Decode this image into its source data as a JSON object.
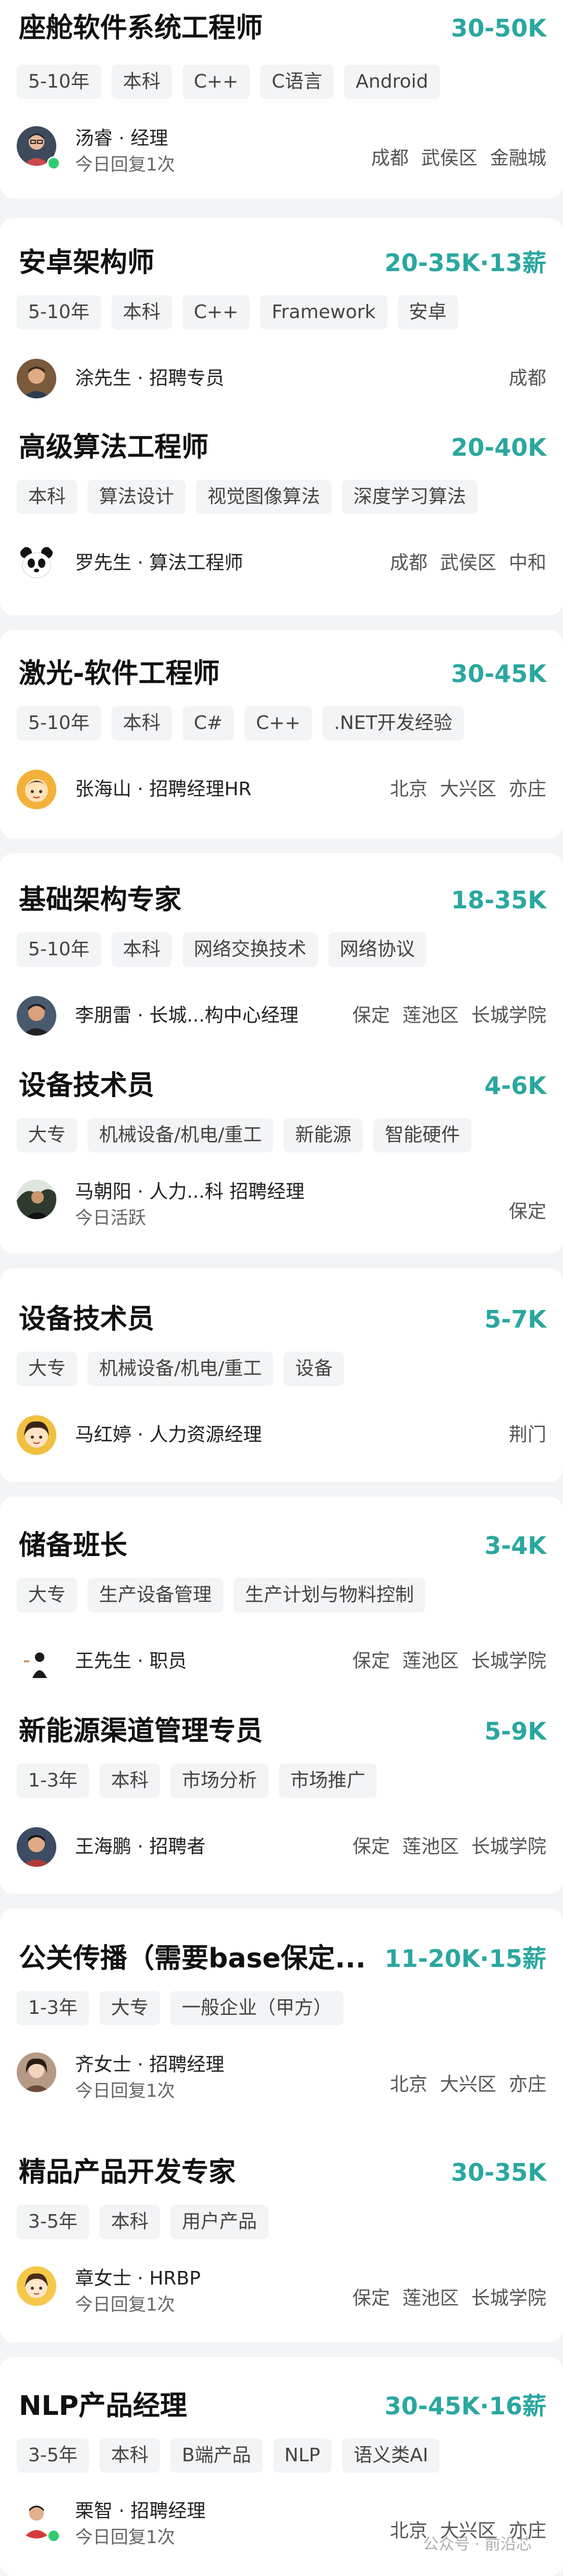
{
  "jobs": [
    {
      "title": "座舱软件系统工程师",
      "salary": "30-50K",
      "tags": [
        "5-10年",
        "本科",
        "C++",
        "C语言",
        "Android"
      ],
      "recruiter": "汤睿 · 经理",
      "status": "今日回复1次",
      "online": true,
      "location": [
        "成都",
        "武侯区",
        "金融城"
      ],
      "avatar": "avatar-man-glasses"
    },
    {
      "title": "安卓架构师",
      "salary": "20-35K·13薪",
      "tags": [
        "5-10年",
        "本科",
        "C++",
        "Framework",
        "安卓"
      ],
      "recruiter": "涂先生 · 招聘专员",
      "status": "",
      "online": false,
      "location": [
        "成都"
      ],
      "avatar": "avatar-man"
    },
    {
      "title": "高级算法工程师",
      "salary": "20-40K",
      "tags": [
        "本科",
        "算法设计",
        "视觉图像算法",
        "深度学习算法"
      ],
      "recruiter": "罗先生 · 算法工程师",
      "status": "",
      "online": false,
      "location": [
        "成都",
        "武侯区",
        "中和"
      ],
      "avatar": "avatar-panda"
    },
    {
      "title": "激光-软件工程师",
      "salary": "30-45K",
      "tags": [
        "5-10年",
        "本科",
        "C#",
        "C++",
        ".NET开发经验"
      ],
      "recruiter": "张海山 · 招聘经理HR",
      "status": "",
      "online": false,
      "location": [
        "北京",
        "大兴区",
        "亦庄"
      ],
      "avatar": "avatar-cartoon"
    },
    {
      "title": "基础架构专家",
      "salary": "18-35K",
      "tags": [
        "5-10年",
        "本科",
        "网络交换技术",
        "网络协议"
      ],
      "recruiter": "李朋雷 · 长城...构中心经理",
      "status": "",
      "online": false,
      "location": [
        "保定",
        "莲池区",
        "长城学院"
      ],
      "avatar": "avatar-man"
    },
    {
      "title": "设备技术员",
      "salary": "4-6K",
      "tags": [
        "大专",
        "机械设备/机电/重工",
        "新能源",
        "智能硬件"
      ],
      "recruiter": "马朝阳 · 人力...科 招聘经理",
      "status": "今日活跃",
      "online": false,
      "location": [
        "保定"
      ],
      "avatar": "avatar-photo"
    },
    {
      "title": "设备技术员",
      "salary": "5-7K",
      "tags": [
        "大专",
        "机械设备/机电/重工",
        "设备"
      ],
      "recruiter": "马红婷 · 人力资源经理",
      "status": "",
      "online": false,
      "location": [
        "荆门"
      ],
      "avatar": "avatar-cartoon"
    },
    {
      "title": "储备班长",
      "salary": "3-4K",
      "tags": [
        "大专",
        "生产设备管理",
        "生产计划与物料控制"
      ],
      "recruiter": "王先生 · 职员",
      "status": "",
      "online": false,
      "location": [
        "保定",
        "莲池区",
        "长城学院"
      ],
      "avatar": "avatar-small"
    },
    {
      "title": "新能源渠道管理专员",
      "salary": "5-9K",
      "tags": [
        "1-3年",
        "本科",
        "市场分析",
        "市场推广"
      ],
      "recruiter": "王海鹏 · 招聘者",
      "status": "",
      "online": false,
      "location": [
        "保定",
        "莲池区",
        "长城学院"
      ],
      "avatar": "avatar-man"
    },
    {
      "title": "公关传播（需要base保定...",
      "salary": "11-20K·15薪",
      "tags": [
        "1-3年",
        "大专",
        "一般企业（甲方）"
      ],
      "recruiter": "齐女士 · 招聘经理",
      "status": "今日回复1次",
      "online": false,
      "location": [
        "北京",
        "大兴区",
        "亦庄"
      ],
      "avatar": "avatar-woman"
    },
    {
      "title": "精品产品开发专家",
      "salary": "30-35K",
      "tags": [
        "3-5年",
        "本科",
        "用户产品"
      ],
      "recruiter": "章女士 · HRBP",
      "status": "今日回复1次",
      "online": false,
      "location": [
        "保定",
        "莲池区",
        "长城学院"
      ],
      "avatar": "avatar-cartoon"
    },
    {
      "title": "NLP产品经理",
      "salary": "30-45K·16薪",
      "tags": [
        "3-5年",
        "本科",
        "B端产品",
        "NLP",
        "语义类AI"
      ],
      "recruiter": "栗智 · 招聘经理",
      "status": "今日回复1次",
      "online": true,
      "location": [
        "北京",
        "大兴区",
        "亦庄"
      ],
      "avatar": "avatar-man-red"
    }
  ],
  "watermark": "公众号 · 前沿芯",
  "colors": {
    "salary": "#2aa7a0",
    "online": "#2ecc71",
    "tag_bg": "#f3f4f6",
    "page_bg": "#f3f4f6"
  }
}
